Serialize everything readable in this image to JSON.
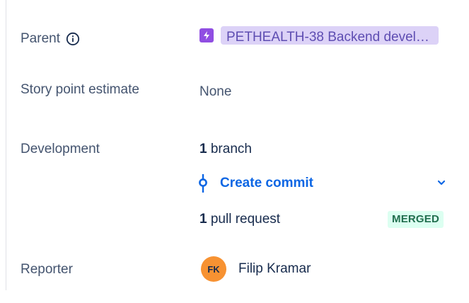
{
  "fields": {
    "parent": {
      "label": "Parent",
      "info_icon": "info-icon",
      "epic_icon": "lightning-bolt-icon",
      "value": "PETHEALTH-38 Backend devel…",
      "epic_color": "#904ee2",
      "lozenge_bg": "#dcd2f7"
    },
    "story_points": {
      "label": "Story point estimate",
      "value": "None"
    },
    "development": {
      "label": "Development",
      "branch_count": "1",
      "branch_text": "branch",
      "commit_icon": "commit-icon",
      "commit_label": "Create commit",
      "chevron_icon": "chevron-down-icon",
      "pr_count": "1",
      "pr_text": "pull request",
      "pr_status": "MERGED",
      "pr_status_bg": "#dcfff1",
      "pr_status_color": "#216e4e"
    },
    "reporter": {
      "label": "Reporter",
      "avatar_initials": "FK",
      "avatar_color": "#f79232",
      "name": "Filip Kramar"
    }
  },
  "colors": {
    "link": "#0c66e4",
    "label": "#44546f",
    "text": "#172b4d"
  }
}
